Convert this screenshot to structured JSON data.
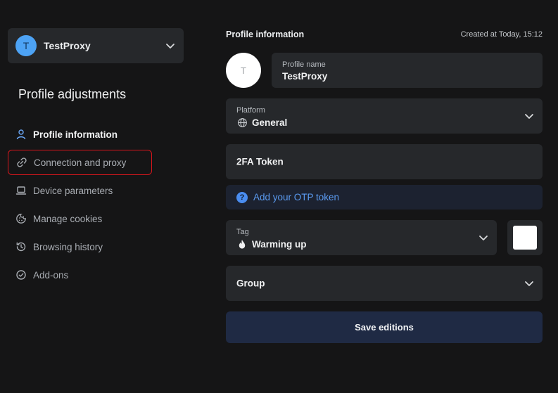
{
  "sidebar": {
    "profile_switcher": {
      "avatar_letter": "T",
      "name": "TestProxy"
    },
    "section_title": "Profile adjustments",
    "nav": [
      {
        "label": "Profile information",
        "icon": "user-icon"
      },
      {
        "label": "Connection and proxy",
        "icon": "link-icon"
      },
      {
        "label": "Device parameters",
        "icon": "laptop-icon"
      },
      {
        "label": "Manage cookies",
        "icon": "cookie-icon"
      },
      {
        "label": "Browsing history",
        "icon": "history-icon"
      },
      {
        "label": "Add-ons",
        "icon": "check-circle-icon"
      }
    ]
  },
  "main": {
    "title": "Profile information",
    "created": "Created at Today, 15:12",
    "avatar_letter": "T",
    "profile_name": {
      "label": "Profile name",
      "value": "TestProxy"
    },
    "platform": {
      "label": "Platform",
      "value": "General",
      "icon": "globe-icon"
    },
    "twofa": {
      "label": "2FA Token"
    },
    "otp": {
      "label": "Add your OTP token",
      "icon": "question-icon"
    },
    "tag": {
      "label": "Tag",
      "value": "Warming up",
      "icon": "fire-icon"
    },
    "group": {
      "label": "Group"
    },
    "save_label": "Save editions"
  },
  "colors": {
    "background": "#151516",
    "panel": "#26282b",
    "accent": "#4a8df0",
    "highlight_border": "#d6161c",
    "save_button": "#1f2a44"
  }
}
